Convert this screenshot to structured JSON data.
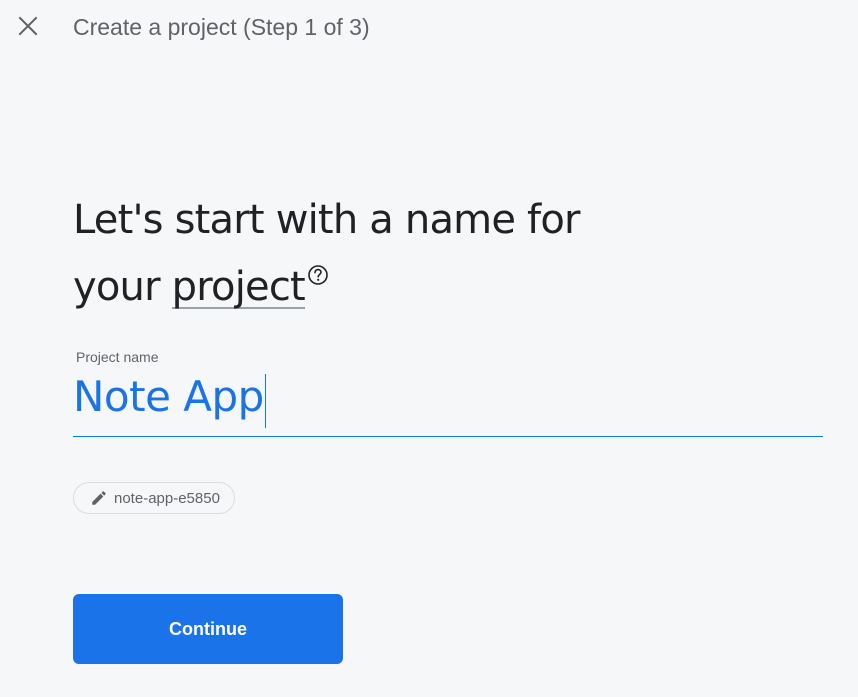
{
  "header": {
    "close_icon": "close-icon",
    "title": "Create a project (Step 1 of 3)"
  },
  "main": {
    "heading_line1": "Let's start with a name for",
    "heading_line2_prefix": "your ",
    "heading_link": "project",
    "help_icon": "help-circle-icon",
    "field_label": "Project name",
    "field_value": "Note App",
    "project_id_chip": {
      "icon": "pencil-icon",
      "label": "note-app-e5850"
    },
    "continue_label": "Continue"
  },
  "colors": {
    "accent": "#1a73e8",
    "background": "#f6f7f9",
    "text_primary": "#202124",
    "text_secondary": "#5f6368"
  }
}
